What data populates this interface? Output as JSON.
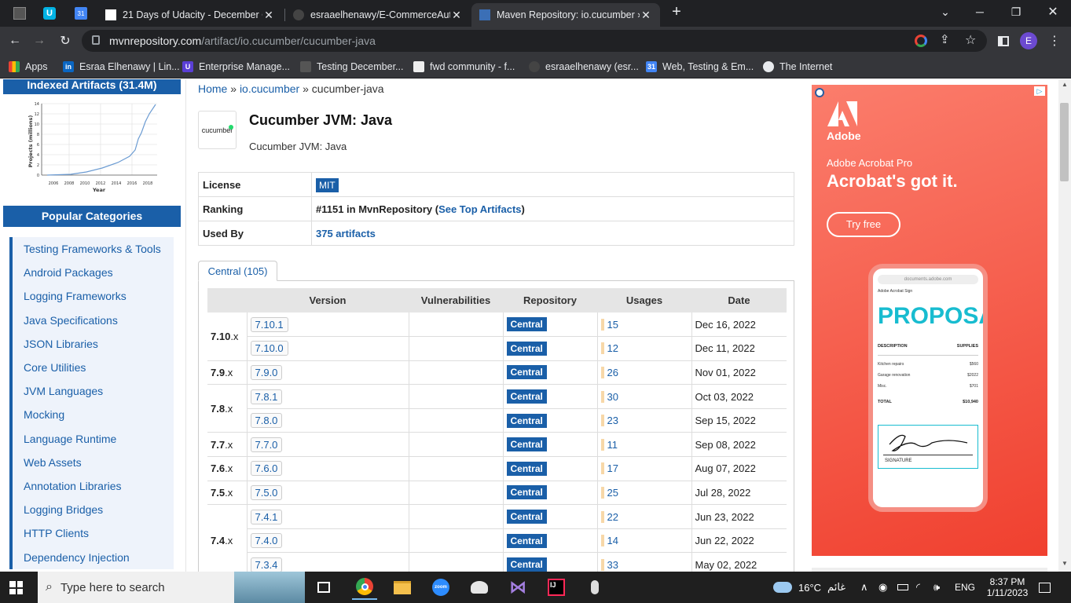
{
  "browser": {
    "tabs": [
      {
        "title": "21 Days of Udacity - December C"
      },
      {
        "title": "esraaelhenawy/E-CommerceAuto"
      },
      {
        "title": "Maven Repository: io.cucumber »"
      }
    ],
    "url_host": "mvnrepository.com",
    "url_path": "/artifact/io.cucumber/cucumber-java",
    "profile_initial": "E",
    "bookmarks": [
      {
        "label": "Apps"
      },
      {
        "label": "Esraa Elhenawy | Lin..."
      },
      {
        "label": "Enterprise Manage..."
      },
      {
        "label": "Testing December..."
      },
      {
        "label": "fwd community - f..."
      },
      {
        "label": "esraaelhenawy (esr..."
      },
      {
        "label": "Web, Testing & Em..."
      },
      {
        "label": "The Internet"
      }
    ]
  },
  "sidebar": {
    "indexed_label": "Indexed Artifacts (31.4M)",
    "chart_ylabel": "Projects (millions)",
    "chart_xlabel": "Year",
    "chart_yticks": [
      "14",
      "12",
      "10",
      "8",
      "6",
      "4",
      "2",
      "0"
    ],
    "chart_xticks": [
      "2006",
      "2008",
      "2010",
      "2012",
      "2014",
      "2016",
      "2018"
    ],
    "popular_label": "Popular Categories",
    "categories": [
      "Testing Frameworks & Tools",
      "Android Packages",
      "Logging Frameworks",
      "Java Specifications",
      "JSON Libraries",
      "Core Utilities",
      "JVM Languages",
      "Mocking",
      "Language Runtime",
      "Web Assets",
      "Annotation Libraries",
      "Logging Bridges",
      "HTTP Clients",
      "Dependency Injection"
    ]
  },
  "breadcrumb": {
    "home": "Home",
    "sep": "»",
    "group": "io.cucumber",
    "artifact": "cucumber-java"
  },
  "artifact": {
    "logo_text": "cucumber",
    "title": "Cucumber JVM: Java",
    "description": "Cucumber JVM: Java",
    "license_label": "License",
    "license_value": "MIT",
    "ranking_label": "Ranking",
    "ranking_value": "#1151 in MvnRepository (",
    "ranking_link": "See Top Artifacts",
    "ranking_close": ")",
    "usedby_label": "Used By",
    "usedby_value": "375 artifacts"
  },
  "versions": {
    "tab_label": "Central (105)",
    "headers": [
      "Version",
      "Vulnerabilities",
      "Repository",
      "Usages",
      "Date"
    ],
    "repo_label": "Central",
    "rows": [
      {
        "major": "7.10",
        "version": "7.10.1",
        "usages": "15",
        "date": "Dec 16, 2022"
      },
      {
        "major": "",
        "version": "7.10.0",
        "usages": "12",
        "date": "Dec 11, 2022"
      },
      {
        "major": "7.9",
        "version": "7.9.0",
        "usages": "26",
        "date": "Nov 01, 2022"
      },
      {
        "major": "7.8",
        "version": "7.8.1",
        "usages": "30",
        "date": "Oct 03, 2022"
      },
      {
        "major": "",
        "version": "7.8.0",
        "usages": "23",
        "date": "Sep 15, 2022"
      },
      {
        "major": "7.7",
        "version": "7.7.0",
        "usages": "11",
        "date": "Sep 08, 2022"
      },
      {
        "major": "7.6",
        "version": "7.6.0",
        "usages": "17",
        "date": "Aug 07, 2022"
      },
      {
        "major": "7.5",
        "version": "7.5.0",
        "usages": "25",
        "date": "Jul 28, 2022"
      },
      {
        "major": "7.4",
        "version": "7.4.1",
        "usages": "22",
        "date": "Jun 23, 2022"
      },
      {
        "major": "",
        "version": "7.4.0",
        "usages": "14",
        "date": "Jun 22, 2022"
      },
      {
        "major": "",
        "version": "7.3.4",
        "usages": "33",
        "date": "May 02, 2022"
      }
    ]
  },
  "ad": {
    "brand": "Adobe",
    "product": "Adobe Acrobat Pro",
    "headline": "Acrobat's got it.",
    "cta": "Try free",
    "phone_url": "documents.adobe.com",
    "phone_app": "Adobe Acrobat Sign",
    "proposal": "PROPOSAL",
    "col_desc": "DESCRIPTION",
    "col_supplies": "SUPPLIES",
    "items": [
      {
        "name": "Kitchen repairs",
        "amount": "$560"
      },
      {
        "name": "Garage renovation",
        "amount": "$2022"
      },
      {
        "name": "Misc.",
        "amount": "$701"
      }
    ],
    "total_label": "TOTAL",
    "total_value": "$10,940",
    "signature_label": "SIGNATURE"
  },
  "taskbar": {
    "search_placeholder": "Type here to search",
    "weather": "16°C",
    "weather_text": "غائم",
    "lang": "ENG",
    "time": "8:37 PM",
    "date": "1/11/2023"
  },
  "colors": {
    "accent": "#1a5fa8",
    "ad_bg": "#f0402f",
    "taskbar": "#1f1f1f"
  }
}
